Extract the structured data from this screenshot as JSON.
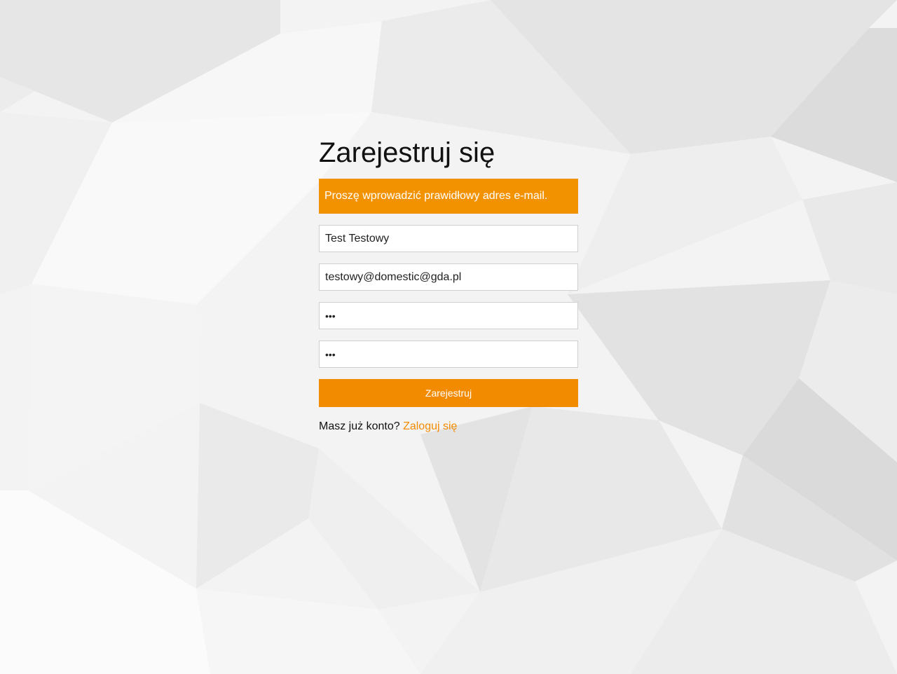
{
  "page": {
    "title": "Zarejestruj się"
  },
  "alert": {
    "text": "Proszę wprowadzić prawidłowy adres e-mail.",
    "color": "#f39200"
  },
  "form": {
    "name_value": "Test Testowy",
    "email_value": "testowy@domestic@gda.pl",
    "password_value": "abc",
    "password_confirm_value": "abc",
    "submit_label": "Zarejestruj"
  },
  "footer": {
    "question": "Masz już konto?",
    "login_link": "Zaloguj się"
  },
  "colors": {
    "accent": "#f38b00",
    "background": "#f2f2f2"
  }
}
